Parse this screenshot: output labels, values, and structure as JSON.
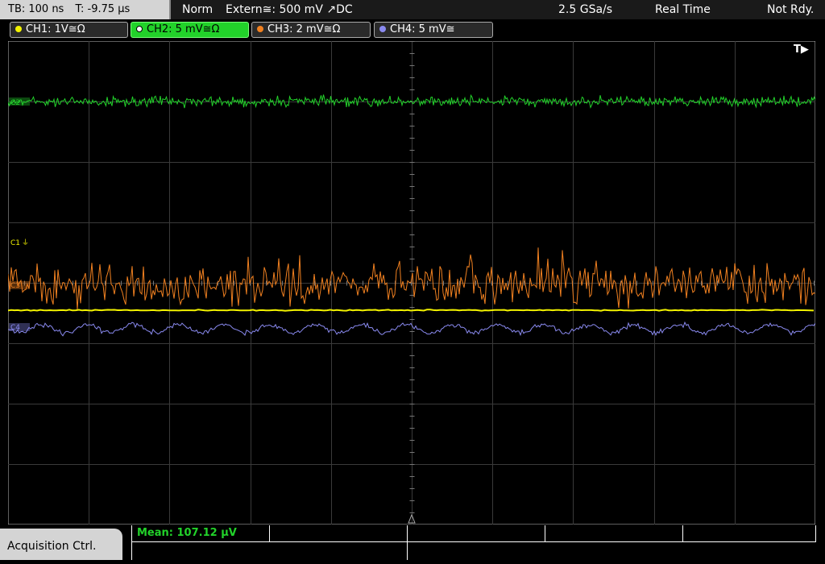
{
  "topbar": {
    "timebase": "TB: 100 ns",
    "trigger_time": "T: -9.75 µs",
    "mode": "Norm",
    "trigger_source": "Extern≅: 500 mV ↗DC",
    "sample_rate": "2.5 GSa/s",
    "acq_mode": "Real Time",
    "status": "Not Rdy."
  },
  "channels": [
    {
      "label": "CH1: 1V≅Ω",
      "color": "#f2f200",
      "active": false
    },
    {
      "label": "CH2: 5 mV≅Ω",
      "color": "#22d22a",
      "active": true
    },
    {
      "label": "CH3: 2 mV≅Ω",
      "color": "#f08020",
      "active": false
    },
    {
      "label": "CH4: 5 mV≅",
      "color": "#8a8af0",
      "active": false
    }
  ],
  "markers": {
    "c1": "C1",
    "c2": "C2",
    "c3": "C3",
    "c4": "C4",
    "trigger": "T▶"
  },
  "bottom": {
    "acquisition_button": "Acquisition Ctrl.",
    "measurement": "Mean: 107.12 µV"
  },
  "colors": {
    "ch1": "#f2f200",
    "ch2": "#22d22a",
    "ch3": "#f08020",
    "ch4": "#8a8af0",
    "grid": "#3a3a3a"
  }
}
